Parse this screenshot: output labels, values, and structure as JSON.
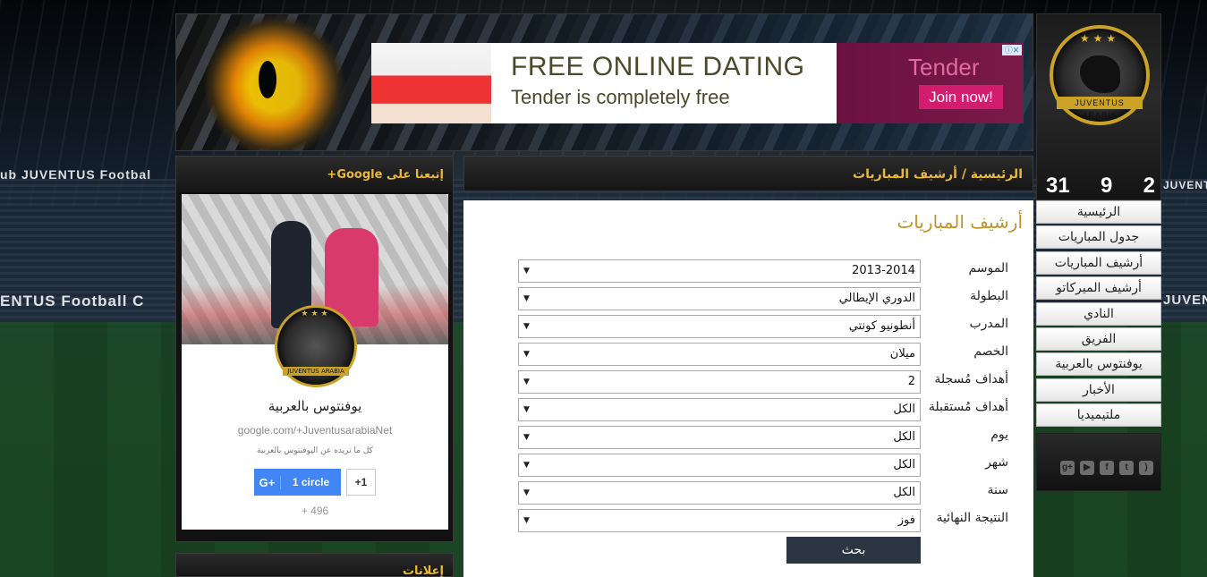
{
  "header": {
    "ad": {
      "title": "FREE ONLINE DATING",
      "subtitle": "Tender is completely free",
      "brand": "Tender",
      "cta": "Join now!"
    }
  },
  "breadcrumb": "الرئيسية / أرشيف المباريات",
  "page_title": "أرشيف المباريات",
  "form": {
    "fields": [
      {
        "label": "الموسم",
        "value": "2013-2014"
      },
      {
        "label": "البطولة",
        "value": "الدوري الإيطالي"
      },
      {
        "label": "المدرب",
        "value": "أنطونيو كونتي"
      },
      {
        "label": "الخصم",
        "value": "ميلان"
      },
      {
        "label": "أهداف مُسجلة",
        "value": "2"
      },
      {
        "label": "أهداف مُستقبلة",
        "value": "الكل"
      },
      {
        "label": "يوم",
        "value": "الكل"
      },
      {
        "label": "شهر",
        "value": "الكل"
      },
      {
        "label": "سنة",
        "value": "الكل"
      },
      {
        "label": "النتيجة النهائية",
        "value": "فوز"
      }
    ],
    "submit_label": "بحث"
  },
  "brand": {
    "logo_text": "JUVENTUS ARABIA",
    "scores": [
      "31",
      "9",
      "2"
    ]
  },
  "menu": {
    "items": [
      "الرئيسية",
      "جدول المباريات",
      "أرشيف المباريات",
      "أرشيف الميركاتو",
      "النادي",
      "الفريق",
      "يوفنتوس بالعربية",
      "الأخبار",
      "ملتيميديا"
    ]
  },
  "social": {
    "icons": [
      "google-plus-icon",
      "youtube-icon",
      "facebook-icon",
      "twitter-icon",
      "rss-icon"
    ]
  },
  "google_widget": {
    "heading": "إتبعنا على Google+",
    "name": "يوفنتوس بالعربية",
    "url": "google.com/+JuventusarabiaNet",
    "description": "كل ما تريده عن اليوفنتوس بالعربية",
    "circle_button": "1 circle",
    "plus_one": "+1",
    "count": "+ 496"
  },
  "ads_widget": {
    "heading": "إعلانات"
  },
  "background_text": {
    "left_top": "ub  JUVENTUS Footbal",
    "left_mid": "ENTUS Football C",
    "right_top": "JUVENTUS",
    "right_mid": "JUVENT"
  }
}
